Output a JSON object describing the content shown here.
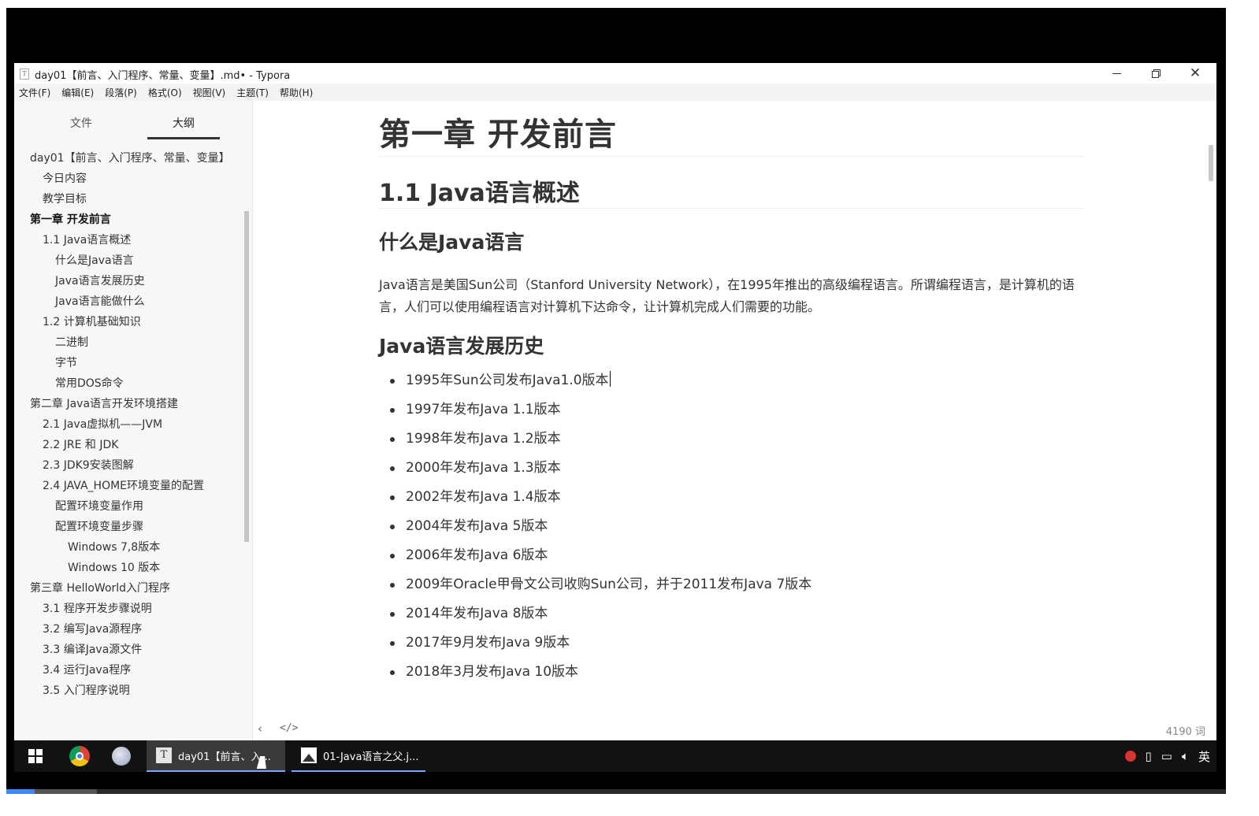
{
  "window": {
    "title": "day01【前言、入门程序、常量、变量】.md• - Typora",
    "app_icon": "T"
  },
  "menu": [
    "文件(F)",
    "编辑(E)",
    "段落(P)",
    "格式(O)",
    "视图(V)",
    "主题(T)",
    "帮助(H)"
  ],
  "sidebar": {
    "tabs": {
      "files": "文件",
      "outline": "大纲"
    },
    "outline": [
      {
        "level": 1,
        "bold": false,
        "text": "day01【前言、入门程序、常量、变量】"
      },
      {
        "level": 2,
        "bold": false,
        "text": "今日内容"
      },
      {
        "level": 2,
        "bold": false,
        "text": "教学目标"
      },
      {
        "level": 1,
        "bold": true,
        "text": "第一章 开发前言"
      },
      {
        "level": 2,
        "bold": false,
        "text": "1.1 Java语言概述"
      },
      {
        "level": 3,
        "bold": false,
        "text": "什么是Java语言"
      },
      {
        "level": 3,
        "bold": false,
        "text": "Java语言发展历史"
      },
      {
        "level": 3,
        "bold": false,
        "text": "Java语言能做什么"
      },
      {
        "level": 2,
        "bold": false,
        "text": "1.2 计算机基础知识"
      },
      {
        "level": 3,
        "bold": false,
        "text": "二进制"
      },
      {
        "level": 3,
        "bold": false,
        "text": "字节"
      },
      {
        "level": 3,
        "bold": false,
        "text": "常用DOS命令"
      },
      {
        "level": 1,
        "bold": false,
        "text": "第二章 Java语言开发环境搭建"
      },
      {
        "level": 2,
        "bold": false,
        "text": "2.1 Java虚拟机——JVM"
      },
      {
        "level": 2,
        "bold": false,
        "text": "2.2 JRE 和 JDK"
      },
      {
        "level": 2,
        "bold": false,
        "text": "2.3 JDK9安装图解"
      },
      {
        "level": 2,
        "bold": false,
        "text": "2.4 JAVA_HOME环境变量的配置"
      },
      {
        "level": 3,
        "bold": false,
        "text": "配置环境变量作用"
      },
      {
        "level": 3,
        "bold": false,
        "text": "配置环境变量步骤"
      },
      {
        "level": 4,
        "bold": false,
        "text": "Windows 7,8版本"
      },
      {
        "level": 4,
        "bold": false,
        "text": "Windows 10 版本"
      },
      {
        "level": 1,
        "bold": false,
        "text": "第三章 HelloWorld入门程序"
      },
      {
        "level": 2,
        "bold": false,
        "text": "3.1 程序开发步骤说明"
      },
      {
        "level": 2,
        "bold": false,
        "text": "3.2 编写Java源程序"
      },
      {
        "level": 2,
        "bold": false,
        "text": "3.3 编译Java源文件"
      },
      {
        "level": 2,
        "bold": false,
        "text": "3.4 运行Java程序"
      },
      {
        "level": 2,
        "bold": false,
        "text": "3.5 入门程序说明"
      }
    ]
  },
  "document": {
    "h1": "第一章 开发前言",
    "h2": "1.1 Java语言概述",
    "h3_what": "什么是Java语言",
    "intro": "Java语言是美国Sun公司（Stanford University Network），在1995年推出的高级编程语言。所谓编程语言，是计算机的语言，人们可以使用编程语言对计算机下达命令，让计算机完成人们需要的功能。",
    "h3_history": "Java语言发展历史",
    "history": [
      "1995年Sun公司发布Java1.0版本",
      "1997年发布Java 1.1版本",
      "1998年发布Java 1.2版本",
      "2000年发布Java 1.3版本",
      "2002年发布Java 1.4版本",
      "2004年发布Java 5版本",
      "2006年发布Java 6版本",
      "2009年Oracle甲骨文公司收购Sun公司，并于2011发布Java 7版本",
      "2014年发布Java 8版本",
      "2017年9月发布Java 9版本",
      "2018年3月发布Java 10版本"
    ]
  },
  "status": {
    "word_count": "4190 词",
    "sidebar_toggle": "‹",
    "source_mode": "</>"
  },
  "taskbar": {
    "typora_label": "day01【前言、入...",
    "photo_label": "01-Java语言之父.j...",
    "ime": "英"
  },
  "video_progress": {
    "played": 0.023,
    "buffered": 0.074
  },
  "icons": [
    "windows-start-icon",
    "chrome-icon",
    "paint-icon",
    "typora-icon",
    "photo-viewer-icon",
    "speaker-icon",
    "network-icon",
    "usb-icon",
    "security-icon"
  ]
}
